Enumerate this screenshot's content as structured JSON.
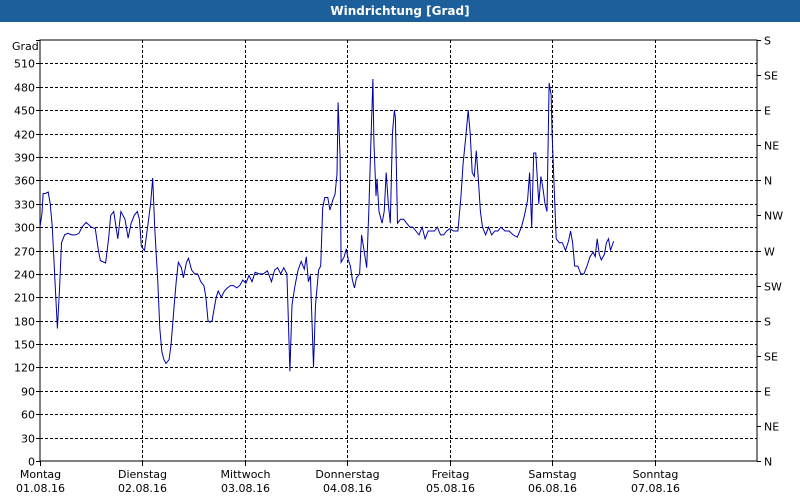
{
  "window": {
    "title": "Windrichtung [Grad]"
  },
  "colors": {
    "titlebar": "#1c5f9a",
    "series": "#0000aa",
    "grid": "#000000"
  },
  "chart_data": {
    "type": "line",
    "title": "Windrichtung [Grad]",
    "ylabel": "Grad",
    "ylim": [
      0,
      540
    ],
    "y_ticks": [
      0,
      30,
      60,
      90,
      120,
      150,
      180,
      210,
      240,
      270,
      300,
      330,
      360,
      390,
      420,
      450,
      480,
      510
    ],
    "y2_ticks": [
      {
        "value": 0,
        "label": "N"
      },
      {
        "value": 45,
        "label": "NE"
      },
      {
        "value": 90,
        "label": "E"
      },
      {
        "value": 135,
        "label": "SE"
      },
      {
        "value": 180,
        "label": "S"
      },
      {
        "value": 225,
        "label": "SW"
      },
      {
        "value": 270,
        "label": "W"
      },
      {
        "value": 315,
        "label": "NW"
      },
      {
        "value": 360,
        "label": "N"
      },
      {
        "value": 405,
        "label": "NE"
      },
      {
        "value": 450,
        "label": "E"
      },
      {
        "value": 495,
        "label": "SE"
      },
      {
        "value": 540,
        "label": "S"
      }
    ],
    "x_ticks": [
      {
        "day": "Montag",
        "date": "01.08.16"
      },
      {
        "day": "Dienstag",
        "date": "02.08.16"
      },
      {
        "day": "Mittwoch",
        "date": "03.08.16"
      },
      {
        "day": "Donnerstag",
        "date": "04.08.16"
      },
      {
        "day": "Freitag",
        "date": "05.08.16"
      },
      {
        "day": "Samstag",
        "date": "06.08.16"
      },
      {
        "day": "Sonntag",
        "date": "07.08.16"
      }
    ],
    "grid": true,
    "series": [
      {
        "values": [
          [
            0.0,
            300
          ],
          [
            0.02,
            318
          ],
          [
            0.03,
            343
          ],
          [
            0.05,
            343
          ],
          [
            0.08,
            345
          ],
          [
            0.1,
            330
          ],
          [
            0.12,
            300
          ],
          [
            0.15,
            220
          ],
          [
            0.17,
            170
          ],
          [
            0.19,
            220
          ],
          [
            0.21,
            280
          ],
          [
            0.24,
            290
          ],
          [
            0.27,
            292
          ],
          [
            0.31,
            290
          ],
          [
            0.35,
            290
          ],
          [
            0.38,
            292
          ],
          [
            0.41,
            300
          ],
          [
            0.45,
            306
          ],
          [
            0.5,
            300
          ],
          [
            0.54,
            298
          ],
          [
            0.57,
            270
          ],
          [
            0.59,
            257
          ],
          [
            0.64,
            254
          ],
          [
            0.67,
            285
          ],
          [
            0.69,
            315
          ],
          [
            0.72,
            320
          ],
          [
            0.76,
            285
          ],
          [
            0.79,
            320
          ],
          [
            0.83,
            310
          ],
          [
            0.86,
            286
          ],
          [
            0.89,
            305
          ],
          [
            0.92,
            315
          ],
          [
            0.95,
            320
          ],
          [
            0.97,
            310
          ],
          [
            0.99,
            275
          ],
          [
            1.02,
            270
          ],
          [
            1.05,
            300
          ],
          [
            1.08,
            330
          ],
          [
            1.1,
            363
          ],
          [
            1.12,
            300
          ],
          [
            1.15,
            230
          ],
          [
            1.17,
            170
          ],
          [
            1.19,
            140
          ],
          [
            1.21,
            130
          ],
          [
            1.23,
            125
          ],
          [
            1.26,
            130
          ],
          [
            1.28,
            150
          ],
          [
            1.31,
            200
          ],
          [
            1.33,
            230
          ],
          [
            1.35,
            255
          ],
          [
            1.38,
            248
          ],
          [
            1.4,
            235
          ],
          [
            1.43,
            255
          ],
          [
            1.45,
            260
          ],
          [
            1.48,
            245
          ],
          [
            1.51,
            240
          ],
          [
            1.54,
            240
          ],
          [
            1.57,
            230
          ],
          [
            1.6,
            225
          ],
          [
            1.62,
            210
          ],
          [
            1.64,
            180
          ],
          [
            1.66,
            178
          ],
          [
            1.68,
            180
          ],
          [
            1.7,
            195
          ],
          [
            1.72,
            210
          ],
          [
            1.74,
            218
          ],
          [
            1.77,
            210
          ],
          [
            1.8,
            218
          ],
          [
            1.83,
            222
          ],
          [
            1.86,
            225
          ],
          [
            1.89,
            225
          ],
          [
            1.92,
            222
          ],
          [
            1.95,
            225
          ],
          [
            1.98,
            232
          ],
          [
            2.01,
            228
          ],
          [
            2.04,
            238
          ],
          [
            2.07,
            230
          ],
          [
            2.1,
            242
          ],
          [
            2.14,
            240
          ],
          [
            2.18,
            240
          ],
          [
            2.22,
            244
          ],
          [
            2.26,
            230
          ],
          [
            2.29,
            245
          ],
          [
            2.32,
            248
          ],
          [
            2.35,
            240
          ],
          [
            2.38,
            248
          ],
          [
            2.41,
            240
          ],
          [
            2.42,
            200
          ],
          [
            2.44,
            115
          ],
          [
            2.46,
            200
          ],
          [
            2.49,
            225
          ],
          [
            2.52,
            245
          ],
          [
            2.55,
            256
          ],
          [
            2.58,
            246
          ],
          [
            2.6,
            262
          ],
          [
            2.62,
            230
          ],
          [
            2.64,
            238
          ],
          [
            2.66,
            160
          ],
          [
            2.67,
            120
          ],
          [
            2.69,
            200
          ],
          [
            2.72,
            245
          ],
          [
            2.74,
            250
          ],
          [
            2.76,
            325
          ],
          [
            2.78,
            338
          ],
          [
            2.81,
            338
          ],
          [
            2.83,
            322
          ],
          [
            2.86,
            335
          ],
          [
            2.88,
            342
          ],
          [
            2.9,
            368
          ],
          [
            2.91,
            460
          ],
          [
            2.93,
            390
          ],
          [
            2.94,
            255
          ],
          [
            2.97,
            262
          ],
          [
            2.99,
            272
          ],
          [
            3.01,
            258
          ],
          [
            3.03,
            250
          ],
          [
            3.05,
            232
          ],
          [
            3.07,
            222
          ],
          [
            3.09,
            235
          ],
          [
            3.12,
            240
          ],
          [
            3.14,
            290
          ],
          [
            3.17,
            265
          ],
          [
            3.19,
            248
          ],
          [
            3.21,
            320
          ],
          [
            3.23,
            405
          ],
          [
            3.25,
            490
          ],
          [
            3.26,
            410
          ],
          [
            3.28,
            340
          ],
          [
            3.29,
            362
          ],
          [
            3.31,
            320
          ],
          [
            3.34,
            305
          ],
          [
            3.36,
            320
          ],
          [
            3.38,
            370
          ],
          [
            3.4,
            330
          ],
          [
            3.42,
            305
          ],
          [
            3.44,
            420
          ],
          [
            3.46,
            450
          ],
          [
            3.47,
            440
          ],
          [
            3.49,
            305
          ],
          [
            3.52,
            310
          ],
          [
            3.55,
            310
          ],
          [
            3.58,
            305
          ],
          [
            3.61,
            300
          ],
          [
            3.64,
            300
          ],
          [
            3.67,
            295
          ],
          [
            3.7,
            290
          ],
          [
            3.73,
            300
          ],
          [
            3.76,
            285
          ],
          [
            3.79,
            295
          ],
          [
            3.82,
            295
          ],
          [
            3.85,
            295
          ],
          [
            3.88,
            300
          ],
          [
            3.91,
            290
          ],
          [
            3.94,
            290
          ],
          [
            3.97,
            295
          ],
          [
            4.0,
            298
          ],
          [
            4.04,
            295
          ],
          [
            4.08,
            295
          ],
          [
            4.11,
            340
          ],
          [
            4.13,
            380
          ],
          [
            4.16,
            420
          ],
          [
            4.18,
            450
          ],
          [
            4.2,
            420
          ],
          [
            4.22,
            370
          ],
          [
            4.24,
            365
          ],
          [
            4.26,
            398
          ],
          [
            4.28,
            360
          ],
          [
            4.3,
            320
          ],
          [
            4.32,
            300
          ],
          [
            4.35,
            290
          ],
          [
            4.38,
            300
          ],
          [
            4.41,
            290
          ],
          [
            4.44,
            295
          ],
          [
            4.47,
            295
          ],
          [
            4.5,
            300
          ],
          [
            4.54,
            295
          ],
          [
            4.58,
            295
          ],
          [
            4.62,
            290
          ],
          [
            4.66,
            287
          ],
          [
            4.7,
            300
          ],
          [
            4.73,
            315
          ],
          [
            4.76,
            335
          ],
          [
            4.78,
            370
          ],
          [
            4.8,
            300
          ],
          [
            4.82,
            395
          ],
          [
            4.84,
            395
          ],
          [
            4.87,
            330
          ],
          [
            4.89,
            365
          ],
          [
            4.91,
            350
          ],
          [
            4.93,
            330
          ],
          [
            4.95,
            320
          ],
          [
            4.97,
            485
          ],
          [
            4.99,
            470
          ],
          [
            5.0,
            420
          ],
          [
            5.02,
            350
          ],
          [
            5.04,
            285
          ],
          [
            5.07,
            280
          ],
          [
            5.1,
            280
          ],
          [
            5.13,
            270
          ],
          [
            5.16,
            282
          ],
          [
            5.18,
            295
          ],
          [
            5.2,
            280
          ],
          [
            5.22,
            250
          ],
          [
            5.25,
            250
          ],
          [
            5.28,
            240
          ],
          [
            5.31,
            240
          ],
          [
            5.34,
            250
          ],
          [
            5.37,
            262
          ],
          [
            5.4,
            268
          ],
          [
            5.42,
            262
          ],
          [
            5.44,
            285
          ],
          [
            5.46,
            265
          ],
          [
            5.48,
            258
          ],
          [
            5.51,
            265
          ],
          [
            5.53,
            280
          ],
          [
            5.55,
            285
          ],
          [
            5.57,
            270
          ],
          [
            5.6,
            282
          ]
        ]
      }
    ]
  }
}
